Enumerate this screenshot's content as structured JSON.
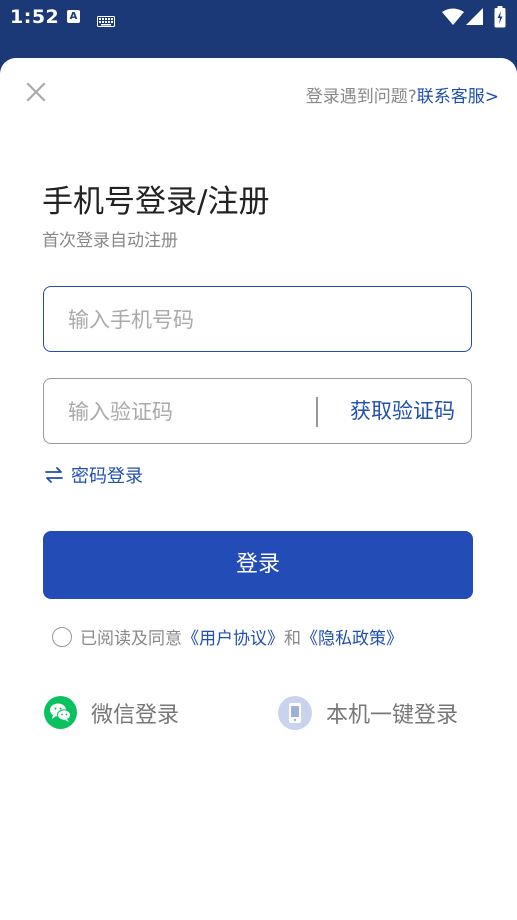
{
  "status_bar": {
    "time": "1:52",
    "notification_a": "A"
  },
  "header": {
    "help_text": "登录遇到问题?",
    "help_link": "联系客服>"
  },
  "main": {
    "title": "手机号登录/注册",
    "subtitle": "首次登录自动注册",
    "phone_placeholder": "输入手机号码",
    "code_placeholder": "输入验证码",
    "get_code_label": "获取验证码",
    "password_login_label": "密码登录",
    "login_button_label": "登录"
  },
  "agreement": {
    "prefix": "已阅读及同意",
    "user_agreement": "《用户协议》",
    "and": "和",
    "privacy_policy": "《隐私政策》"
  },
  "alt_login": {
    "wechat_label": "微信登录",
    "onekey_label": "本机一键登录"
  },
  "colors": {
    "accent": "#234cb7",
    "link": "#1f4fb1",
    "status_bar_bg": "#1b3877",
    "wechat_green": "#0ac160"
  }
}
